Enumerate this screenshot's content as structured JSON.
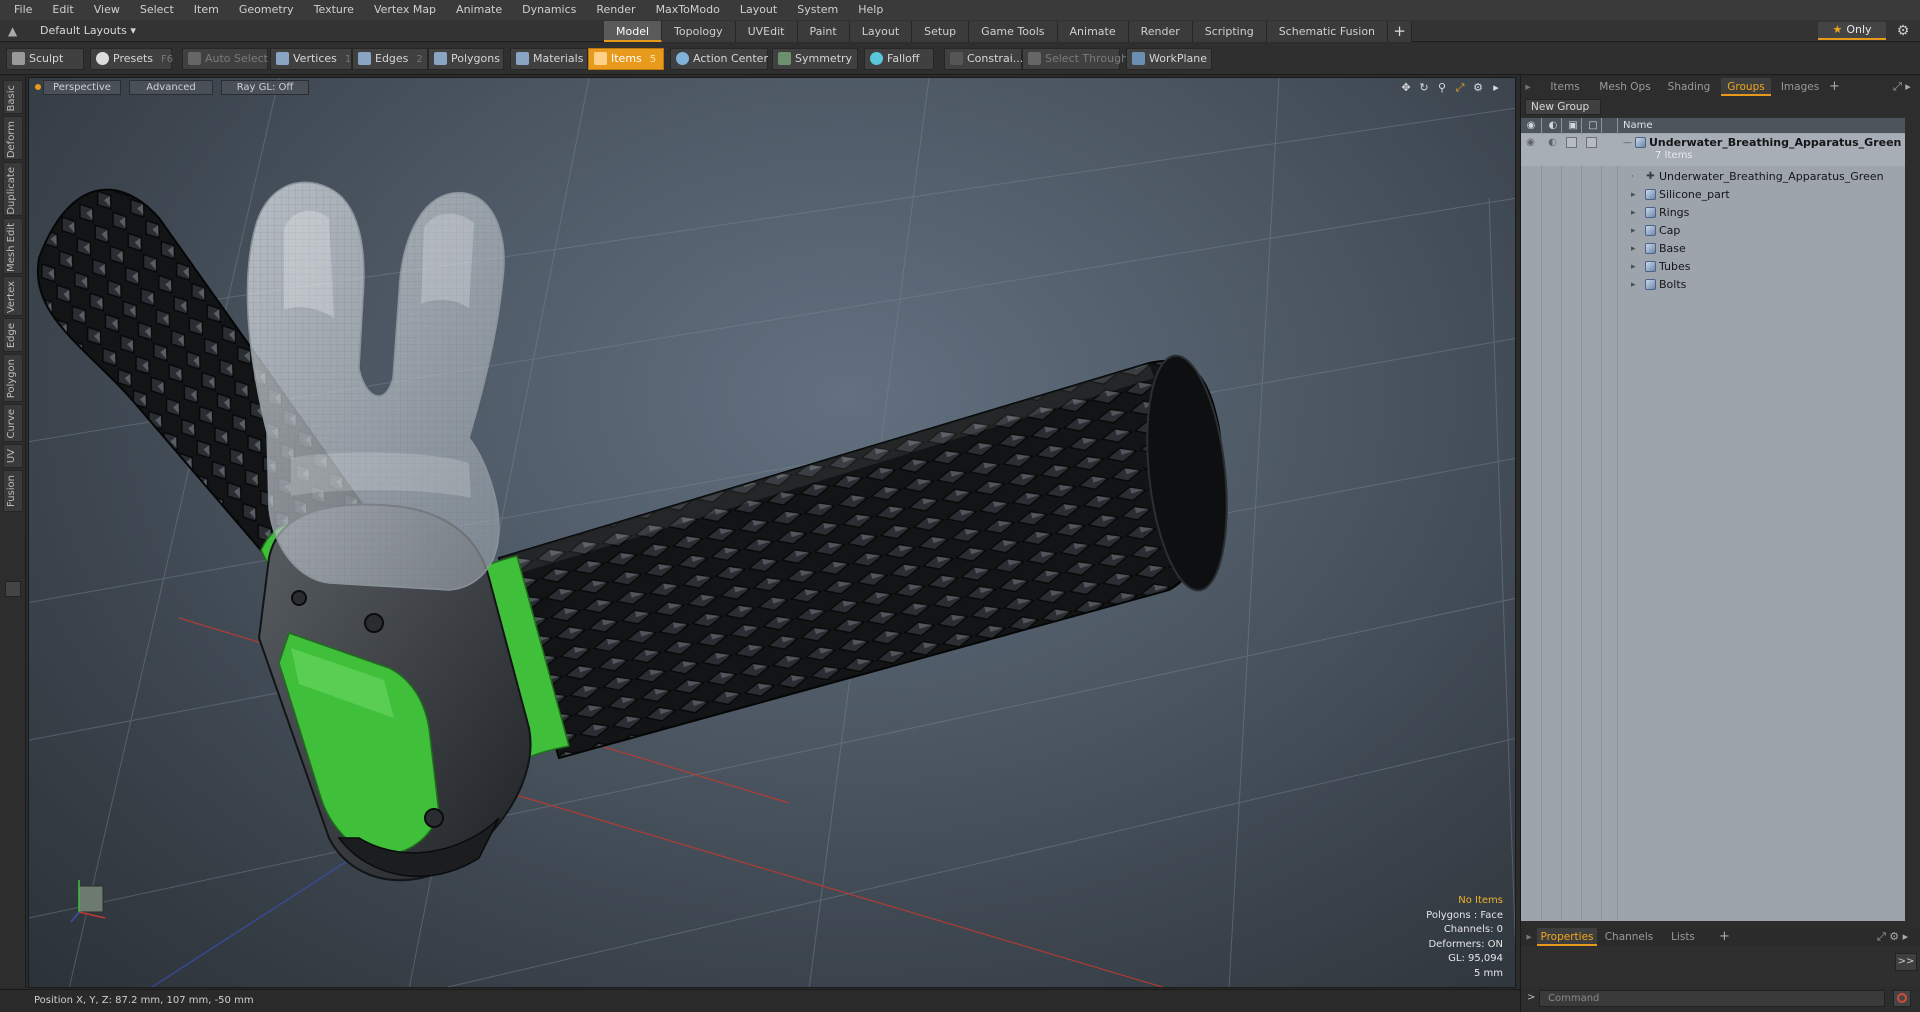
{
  "menu": [
    "File",
    "Edit",
    "View",
    "Select",
    "Item",
    "Geometry",
    "Texture",
    "Vertex Map",
    "Animate",
    "Dynamics",
    "Render",
    "MaxToModo",
    "Layout",
    "System",
    "Help"
  ],
  "layout_dropdown": "Default Layouts",
  "mode_tabs": [
    "Model",
    "Topology",
    "UVEdit",
    "Paint",
    "Layout",
    "Setup",
    "Game Tools",
    "Animate",
    "Render",
    "Scripting",
    "Schematic Fusion"
  ],
  "mode_add": "+",
  "only_button": "Only",
  "toolbar": {
    "sculpt": "Sculpt",
    "presets": "Presets",
    "presets_key": "F6",
    "auto_select": "Auto Select",
    "vertices": "Vertices",
    "vertices_count": "1",
    "edges": "Edges",
    "edges_count": "2",
    "polygons": "Polygons",
    "materials": "Materials",
    "items": "Items",
    "items_count": "5",
    "action_center": "Action Center",
    "symmetry": "Symmetry",
    "falloff": "Falloff",
    "constrain": "Constrai...",
    "select_through": "Select Through",
    "workplane": "WorkPlane"
  },
  "left_tabs": [
    "Basic",
    "Deform",
    "Duplicate",
    "Mesh Edit",
    "Vertex",
    "Edge",
    "Polygon",
    "Curve",
    "UV",
    "Fusion"
  ],
  "viewport": {
    "view": "Perspective",
    "shading": "Advanced",
    "raygl": "Ray GL: Off",
    "info": {
      "selection": "No Items",
      "polygons": "Polygons : Face",
      "channels": "Channels: 0",
      "deformers": "Deformers: ON",
      "gl": "GL: 95,094",
      "unit": "5 mm"
    }
  },
  "status": {
    "position": "Position X, Y, Z:  87.2 mm, 107 mm, -50 mm"
  },
  "right_panel": {
    "tabs": [
      "Items",
      "Mesh Ops",
      "Shading",
      "Groups",
      "Images"
    ],
    "active_tab": "Groups",
    "add": "+",
    "new_group": "New Group",
    "name_col": "Name",
    "group": {
      "name": "Underwater_Breathing_Apparatus_Green ...",
      "count": "7 Items"
    },
    "items": [
      "Underwater_Breathing_Apparatus_Green",
      "Silicone_part",
      "Rings",
      "Cap",
      "Base",
      "Tubes",
      "Bolts"
    ],
    "bottom_tabs": [
      "Properties",
      "Channels",
      "Lists"
    ],
    "bottom_add": "+",
    "more": ">>",
    "cmd_prompt": ">",
    "command_placeholder": "Command"
  },
  "colors": {
    "accent_orange": "#e79a1a",
    "apparatus_green": "#3fbf3a",
    "rubber_black": "#181a1c",
    "info_highlight": "#f0b02a"
  }
}
